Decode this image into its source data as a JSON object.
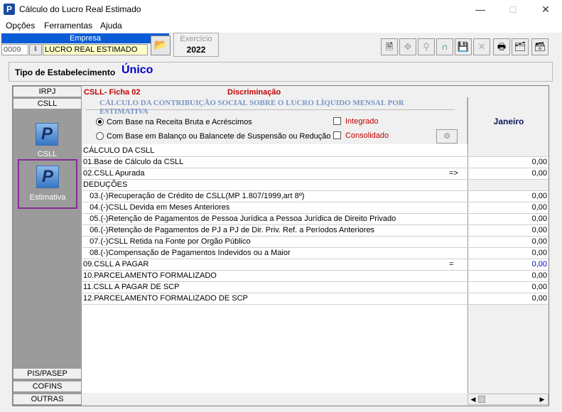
{
  "window": {
    "title": "Cálculo do Lucro Real Estimado",
    "app_icon": "P",
    "minimize": "—",
    "maximize": "□",
    "close": "✕"
  },
  "menu": [
    "Opções",
    "Ferramentas",
    "Ajuda"
  ],
  "empresa": {
    "label": "Empresa",
    "code": "0009",
    "name": "LUCRO REAL ESTIMADO"
  },
  "exercicio": {
    "label": "Exercício",
    "value": "2022"
  },
  "toolbar": {
    "icons": [
      "document-icon",
      "navigate-icon",
      "search-tools-icon",
      "unlock-icon",
      "save-icon",
      "delete-icon",
      "print-icon",
      "folders-icon",
      "export-icon"
    ]
  },
  "tipo": {
    "label": "Tipo de Estabelecimento",
    "value": "Único"
  },
  "tabs_top": [
    "IRPJ",
    "CSLL"
  ],
  "side_icons": [
    {
      "label": "CSLL"
    },
    {
      "label": "Estimativa"
    }
  ],
  "tabs_bottom": [
    "PIS/PASEP",
    "COFINS",
    "OUTRAS"
  ],
  "header": {
    "ficha": "CSLL- Ficha 02",
    "discriminacao": "Discriminação"
  },
  "panel": {
    "title": "CÁLCULO DA CONTRIBUIÇÃO SOCIAL SOBRE O LUCRO LÍQUIDO MENSAL POR ESTIMATIVA",
    "option1": "Com Base na  Receita Bruta e Acréscimos",
    "option2": "Com Base em Balanço ou Balancete de Suspensão ou Redução",
    "integrado": "Integrado",
    "consolidado": "Consolidado"
  },
  "month": "Janeiro",
  "rows": [
    {
      "label": "CÁLCULO DA CSLL",
      "sym": "",
      "value": null
    },
    {
      "label": "01.Base de Cálculo da CSLL",
      "sym": "",
      "value": "0,00"
    },
    {
      "label": "02.CSLL Apurada",
      "sym": "=>",
      "value": "0,00"
    },
    {
      "label": "DEDUÇÕES",
      "sym": "",
      "value": null
    },
    {
      "label": "   03.(-)Recuperação de Crédito de CSLL(MP 1.807/1999,art 8º)",
      "sym": "",
      "value": "0,00"
    },
    {
      "label": "   04.(-)CSLL Devida em Meses Anteriores",
      "sym": "",
      "value": "0,00"
    },
    {
      "label": "   05.(-)Retenção de Pagamentos de Pessoa Jurídica a Pessoa Jurídica de Direito Privado",
      "sym": "",
      "value": "0,00"
    },
    {
      "label": "   06.(-)Retenção de Pagamentos de PJ a PJ de Dir. Priv. Ref. a Períodos Anteriores",
      "sym": "",
      "value": "0,00"
    },
    {
      "label": "   07.(-)CSLL Retida na Fonte por Orgão Público",
      "sym": "",
      "value": "0,00"
    },
    {
      "label": "   08.(-)Compensação de Pagamentos Indevidos ou a Maior",
      "sym": "",
      "value": "0,00"
    },
    {
      "label": "09.CSLL A PAGAR",
      "sym": "=",
      "value": "0,00",
      "blue": true
    },
    {
      "label": "10.PARCELAMENTO FORMALIZADO",
      "sym": "",
      "value": "0,00"
    },
    {
      "label": "11.CSLL A PAGAR DE SCP",
      "sym": "",
      "value": "0,00"
    },
    {
      "label": "12.PARCELAMENTO FORMALIZADO DE SCP",
      "sym": "",
      "value": "0,00"
    }
  ]
}
